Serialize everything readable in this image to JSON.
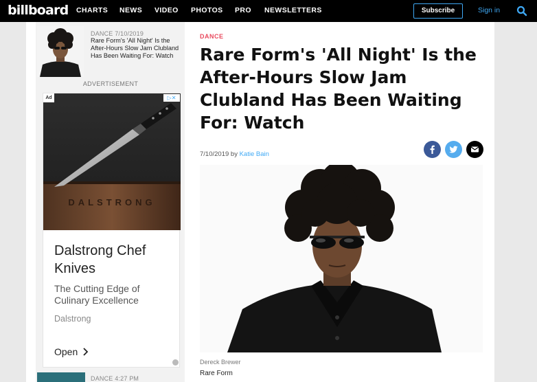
{
  "nav": {
    "logo": "billboard",
    "items": [
      "CHARTS",
      "NEWS",
      "VIDEO",
      "PHOTOS",
      "PRO",
      "NEWSLETTERS"
    ],
    "subscribe": "Subscribe",
    "signin": "Sign in"
  },
  "sidebar": {
    "card1": {
      "meta": "DANCE 7/10/2019",
      "title": "Rare Form's 'All Night' Is the After-Hours Slow Jam Clubland Has Been Waiting For: Watch"
    },
    "ad_label": "ADVERTISEMENT",
    "ad": {
      "badge": "Ad",
      "brand_mark": "DALSTRONG",
      "headline": "Dalstrong Chef Knives",
      "desc": "The Cutting Edge of Culinary Excellence",
      "brand": "Dalstrong",
      "cta": "Open"
    },
    "card2": {
      "meta": "DANCE 4:27 PM"
    }
  },
  "article": {
    "kicker": "DANCE",
    "headline": "Rare Form's 'All Night' Is the After-Hours Slow Jam Clubland Has Been Waiting For: Watch",
    "date": "7/10/2019",
    "by": "by",
    "author": "Katie Bain",
    "photo_credit": "Dereck Brewer",
    "caption": "Rare Form"
  },
  "colors": {
    "accent": "#3fa9f5",
    "kicker": "#e94a5e",
    "facebook": "#3b5998",
    "twitter": "#55acee",
    "email": "#000000"
  },
  "icons": {
    "search": "search-icon",
    "facebook": "facebook-icon",
    "twitter": "twitter-icon",
    "email": "email-icon",
    "ad_info": "info-icon",
    "chevron": "chevron-right-icon"
  }
}
